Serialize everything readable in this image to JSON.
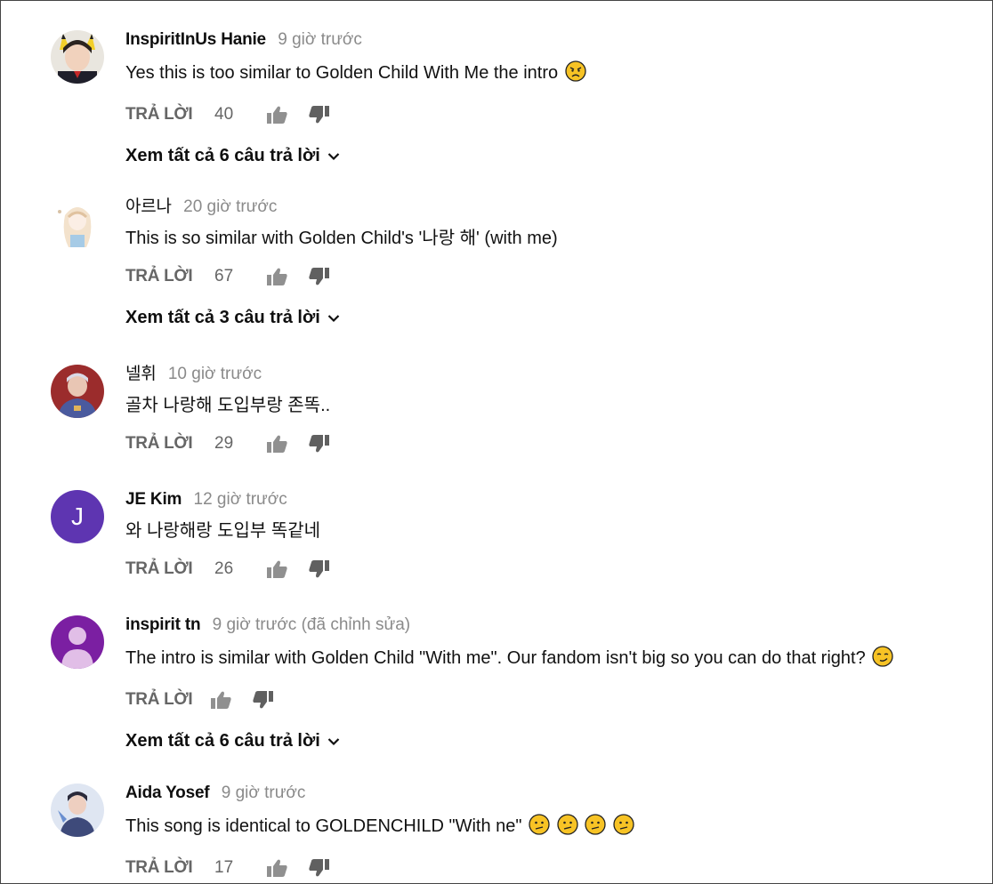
{
  "labels": {
    "reply": "TRẢ LỜI"
  },
  "comments": [
    {
      "author": "InspiritInUs Hanie",
      "time": "9 giờ trước",
      "text": "Yes this is too similar to Golden Child With Me the intro",
      "emoji": [
        "angry-face"
      ],
      "likes": "40",
      "replies_label": "Xem tất cả 6 câu trả lời"
    },
    {
      "author": "아르나",
      "time": "20 giờ trước",
      "text": "This is so similar with Golden Child's '나랑 해' (with me)",
      "likes": "67",
      "replies_label": "Xem tất cả 3 câu trả lời"
    },
    {
      "author": "넬휘",
      "time": "10 giờ trước",
      "text": "골차 나랑해 도입부랑 존똑..",
      "likes": "29"
    },
    {
      "author": "JE Kim",
      "time": "12 giờ trước",
      "text": "와 나랑해랑 도입부 똑같네",
      "likes": "26",
      "avatar_letter": "J"
    },
    {
      "author": "inspirit tn",
      "time": "9 giờ trước (đã chỉnh sửa)",
      "text": "The intro is similar with Golden Child \"With me\". Our fandom isn't big  so you can do that right?",
      "emoji": [
        "smirking-face"
      ],
      "likes": "",
      "replies_label": "Xem tất cả 6 câu trả lời"
    },
    {
      "author": "Aida Yosef",
      "time": "9 giờ trước",
      "text": "This song is identical to GOLDENCHILD \"With ne\"",
      "emoji": [
        "confused-face",
        "confused-face",
        "confused-face",
        "confused-face"
      ],
      "likes": "17"
    }
  ],
  "colors": {
    "timestamp": "#8a8a8a",
    "action_gray": "#666666",
    "avatar_purple_letter": "#5e35b1",
    "avatar_default": "#7b1fa2",
    "emoji_yellow": "#f7c325"
  }
}
